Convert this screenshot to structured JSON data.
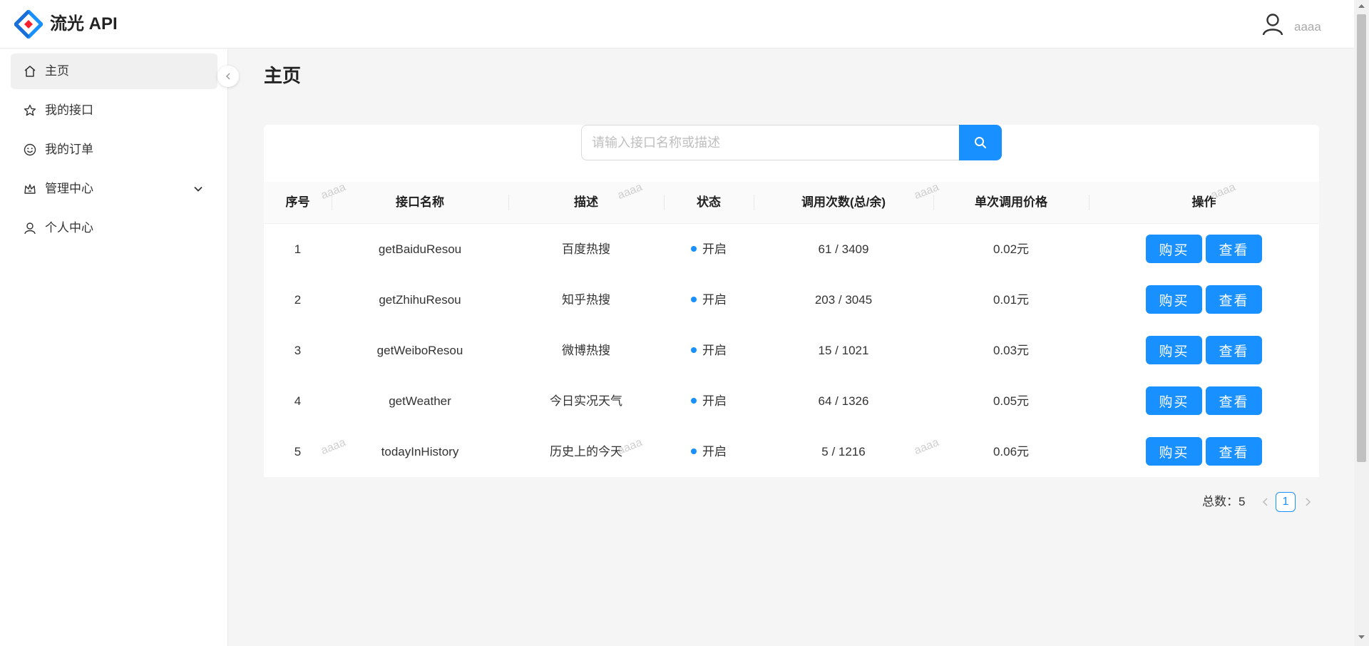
{
  "app": {
    "title": "流光 API"
  },
  "user": {
    "name": "aaaa"
  },
  "sidebar": {
    "items": [
      {
        "label": "主页",
        "icon": "home-icon"
      },
      {
        "label": "我的接口",
        "icon": "star-icon"
      },
      {
        "label": "我的订单",
        "icon": "smile-icon"
      },
      {
        "label": "管理中心",
        "icon": "crown-icon"
      },
      {
        "label": "个人中心",
        "icon": "user-icon"
      }
    ]
  },
  "page": {
    "title": "主页"
  },
  "search": {
    "placeholder": "请输入接口名称或描述"
  },
  "table": {
    "headers": [
      "序号",
      "接口名称",
      "描述",
      "状态",
      "调用次数(总/余)",
      "单次调用价格",
      "操作"
    ],
    "rows": [
      {
        "index": "1",
        "name": "getBaiduResou",
        "desc": "百度热搜",
        "status": "开启",
        "calls": "61 / 3409",
        "price": "0.02元"
      },
      {
        "index": "2",
        "name": "getZhihuResou",
        "desc": "知乎热搜",
        "status": "开启",
        "calls": "203 / 3045",
        "price": "0.01元"
      },
      {
        "index": "3",
        "name": "getWeiboResou",
        "desc": "微博热搜",
        "status": "开启",
        "calls": "15 / 1021",
        "price": "0.03元"
      },
      {
        "index": "4",
        "name": "getWeather",
        "desc": "今日实况天气",
        "status": "开启",
        "calls": "64 / 1326",
        "price": "0.05元"
      },
      {
        "index": "5",
        "name": "todayInHistory",
        "desc": "历史上的今天",
        "status": "开启",
        "calls": "5 / 1216",
        "price": "0.06元"
      }
    ],
    "actions": {
      "buy": "购买",
      "view": "查看"
    }
  },
  "watermark": "aaaa",
  "pagination": {
    "total_label": "总数：5",
    "current": "1"
  },
  "colors": {
    "primary": "#1890ff"
  }
}
